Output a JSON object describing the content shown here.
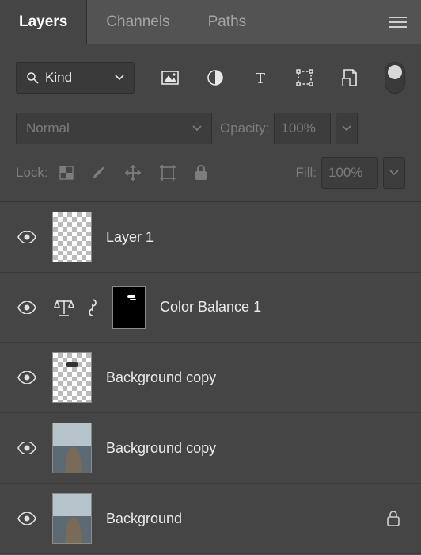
{
  "tabs": {
    "layers": "Layers",
    "channels": "Channels",
    "paths": "Paths"
  },
  "filter": {
    "kind_label": "Kind"
  },
  "blend": {
    "mode": "Normal",
    "opacity_label": "Opacity:",
    "opacity_value": "100%"
  },
  "lock": {
    "label": "Lock:",
    "fill_label": "Fill:",
    "fill_value": "100%"
  },
  "layers": [
    {
      "name": "Layer 1"
    },
    {
      "name": "Color Balance 1"
    },
    {
      "name": "Background copy"
    },
    {
      "name": "Background copy"
    },
    {
      "name": "Background"
    }
  ]
}
